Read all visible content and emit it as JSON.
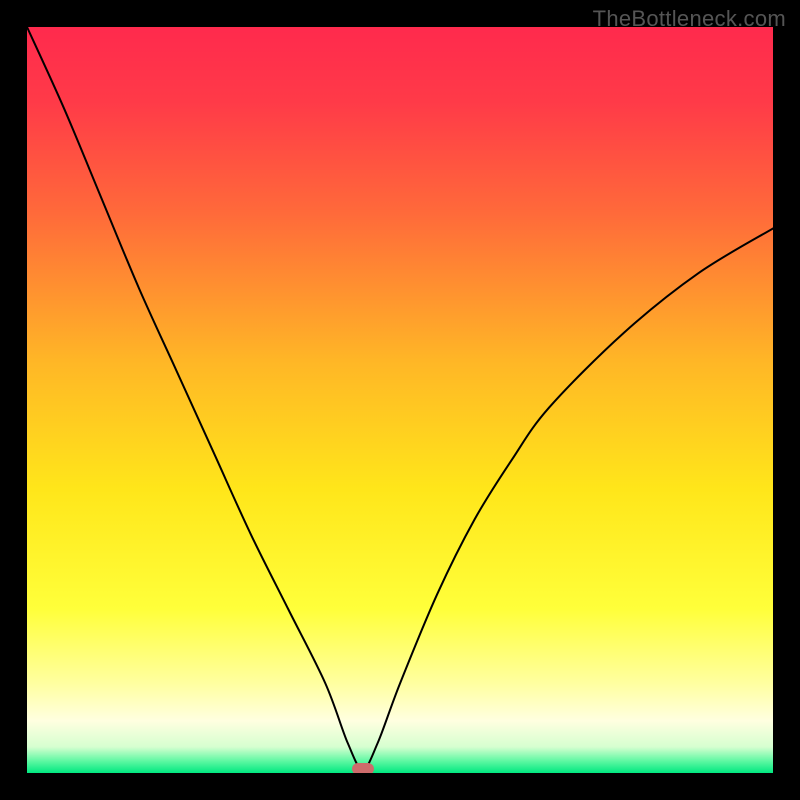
{
  "watermark": "TheBottleneck.com",
  "chart_data": {
    "type": "line",
    "title": "",
    "xlabel": "",
    "ylabel": "",
    "xlim": [
      0,
      100
    ],
    "ylim": [
      0,
      100
    ],
    "series": [
      {
        "name": "bottleneck-curve",
        "x": [
          0,
          5,
          10,
          15,
          20,
          25,
          30,
          35,
          40,
          43,
          45,
          47,
          50,
          55,
          60,
          65,
          70,
          80,
          90,
          100
        ],
        "values": [
          100,
          89,
          77,
          65,
          54,
          43,
          32,
          22,
          12,
          4,
          0.5,
          4,
          12,
          24,
          34,
          42,
          49,
          59,
          67,
          73
        ]
      }
    ],
    "marker": {
      "x": 45,
      "y": 0.5,
      "color": "#cd6b6b"
    },
    "gradient_stops": [
      {
        "pos": 0.0,
        "color": "#ff2a4d"
      },
      {
        "pos": 0.1,
        "color": "#ff3a48"
      },
      {
        "pos": 0.25,
        "color": "#ff6a3a"
      },
      {
        "pos": 0.45,
        "color": "#ffb726"
      },
      {
        "pos": 0.62,
        "color": "#ffe61a"
      },
      {
        "pos": 0.78,
        "color": "#ffff3a"
      },
      {
        "pos": 0.88,
        "color": "#ffffa0"
      },
      {
        "pos": 0.93,
        "color": "#ffffe0"
      },
      {
        "pos": 0.965,
        "color": "#d6ffd0"
      },
      {
        "pos": 0.985,
        "color": "#58f7a0"
      },
      {
        "pos": 1.0,
        "color": "#00e880"
      }
    ],
    "curve_color": "#000000",
    "curve_width": 2
  }
}
